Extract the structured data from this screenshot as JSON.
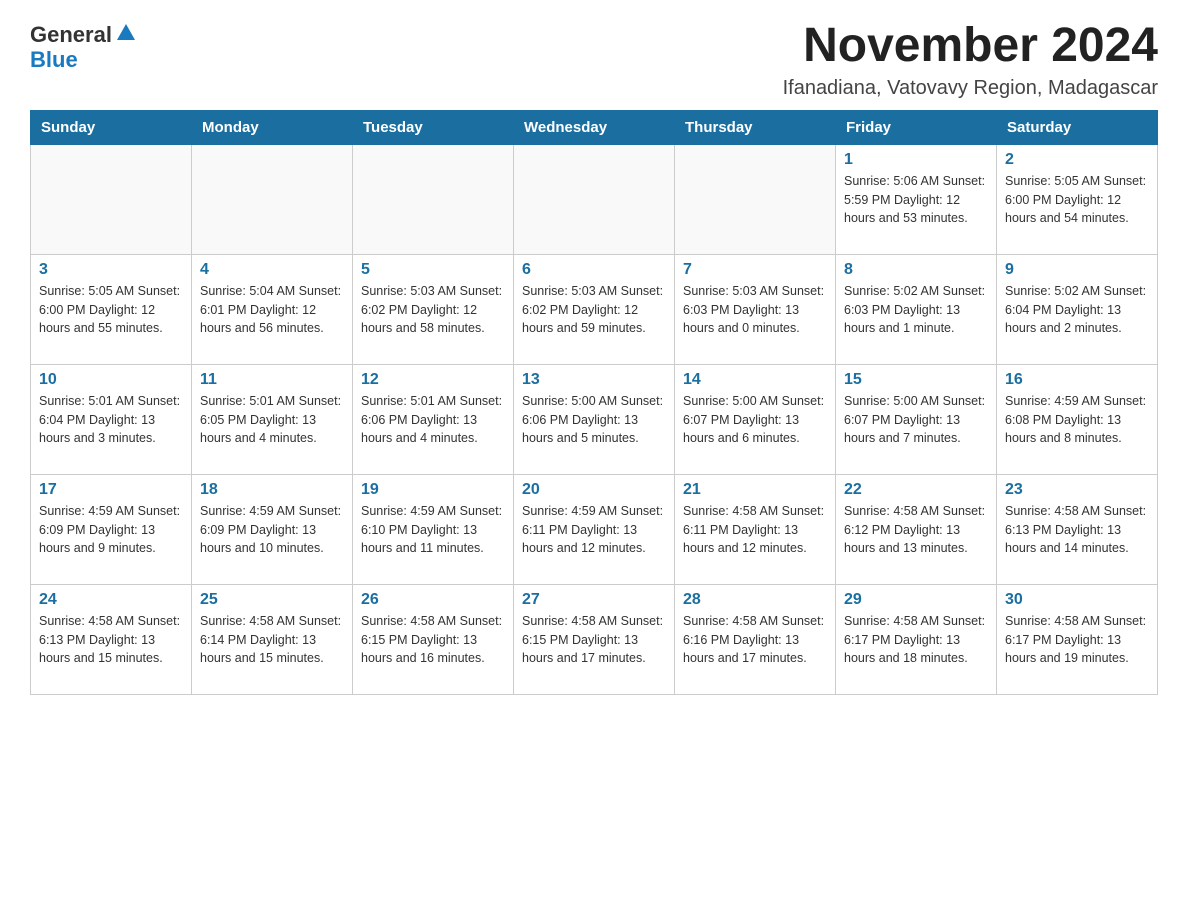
{
  "logo": {
    "general": "General",
    "blue": "Blue"
  },
  "title": "November 2024",
  "subtitle": "Ifanadiana, Vatovavy Region, Madagascar",
  "weekdays": [
    "Sunday",
    "Monday",
    "Tuesday",
    "Wednesday",
    "Thursday",
    "Friday",
    "Saturday"
  ],
  "weeks": [
    [
      {
        "day": "",
        "info": ""
      },
      {
        "day": "",
        "info": ""
      },
      {
        "day": "",
        "info": ""
      },
      {
        "day": "",
        "info": ""
      },
      {
        "day": "",
        "info": ""
      },
      {
        "day": "1",
        "info": "Sunrise: 5:06 AM\nSunset: 5:59 PM\nDaylight: 12 hours\nand 53 minutes."
      },
      {
        "day": "2",
        "info": "Sunrise: 5:05 AM\nSunset: 6:00 PM\nDaylight: 12 hours\nand 54 minutes."
      }
    ],
    [
      {
        "day": "3",
        "info": "Sunrise: 5:05 AM\nSunset: 6:00 PM\nDaylight: 12 hours\nand 55 minutes."
      },
      {
        "day": "4",
        "info": "Sunrise: 5:04 AM\nSunset: 6:01 PM\nDaylight: 12 hours\nand 56 minutes."
      },
      {
        "day": "5",
        "info": "Sunrise: 5:03 AM\nSunset: 6:02 PM\nDaylight: 12 hours\nand 58 minutes."
      },
      {
        "day": "6",
        "info": "Sunrise: 5:03 AM\nSunset: 6:02 PM\nDaylight: 12 hours\nand 59 minutes."
      },
      {
        "day": "7",
        "info": "Sunrise: 5:03 AM\nSunset: 6:03 PM\nDaylight: 13 hours\nand 0 minutes."
      },
      {
        "day": "8",
        "info": "Sunrise: 5:02 AM\nSunset: 6:03 PM\nDaylight: 13 hours\nand 1 minute."
      },
      {
        "day": "9",
        "info": "Sunrise: 5:02 AM\nSunset: 6:04 PM\nDaylight: 13 hours\nand 2 minutes."
      }
    ],
    [
      {
        "day": "10",
        "info": "Sunrise: 5:01 AM\nSunset: 6:04 PM\nDaylight: 13 hours\nand 3 minutes."
      },
      {
        "day": "11",
        "info": "Sunrise: 5:01 AM\nSunset: 6:05 PM\nDaylight: 13 hours\nand 4 minutes."
      },
      {
        "day": "12",
        "info": "Sunrise: 5:01 AM\nSunset: 6:06 PM\nDaylight: 13 hours\nand 4 minutes."
      },
      {
        "day": "13",
        "info": "Sunrise: 5:00 AM\nSunset: 6:06 PM\nDaylight: 13 hours\nand 5 minutes."
      },
      {
        "day": "14",
        "info": "Sunrise: 5:00 AM\nSunset: 6:07 PM\nDaylight: 13 hours\nand 6 minutes."
      },
      {
        "day": "15",
        "info": "Sunrise: 5:00 AM\nSunset: 6:07 PM\nDaylight: 13 hours\nand 7 minutes."
      },
      {
        "day": "16",
        "info": "Sunrise: 4:59 AM\nSunset: 6:08 PM\nDaylight: 13 hours\nand 8 minutes."
      }
    ],
    [
      {
        "day": "17",
        "info": "Sunrise: 4:59 AM\nSunset: 6:09 PM\nDaylight: 13 hours\nand 9 minutes."
      },
      {
        "day": "18",
        "info": "Sunrise: 4:59 AM\nSunset: 6:09 PM\nDaylight: 13 hours\nand 10 minutes."
      },
      {
        "day": "19",
        "info": "Sunrise: 4:59 AM\nSunset: 6:10 PM\nDaylight: 13 hours\nand 11 minutes."
      },
      {
        "day": "20",
        "info": "Sunrise: 4:59 AM\nSunset: 6:11 PM\nDaylight: 13 hours\nand 12 minutes."
      },
      {
        "day": "21",
        "info": "Sunrise: 4:58 AM\nSunset: 6:11 PM\nDaylight: 13 hours\nand 12 minutes."
      },
      {
        "day": "22",
        "info": "Sunrise: 4:58 AM\nSunset: 6:12 PM\nDaylight: 13 hours\nand 13 minutes."
      },
      {
        "day": "23",
        "info": "Sunrise: 4:58 AM\nSunset: 6:13 PM\nDaylight: 13 hours\nand 14 minutes."
      }
    ],
    [
      {
        "day": "24",
        "info": "Sunrise: 4:58 AM\nSunset: 6:13 PM\nDaylight: 13 hours\nand 15 minutes."
      },
      {
        "day": "25",
        "info": "Sunrise: 4:58 AM\nSunset: 6:14 PM\nDaylight: 13 hours\nand 15 minutes."
      },
      {
        "day": "26",
        "info": "Sunrise: 4:58 AM\nSunset: 6:15 PM\nDaylight: 13 hours\nand 16 minutes."
      },
      {
        "day": "27",
        "info": "Sunrise: 4:58 AM\nSunset: 6:15 PM\nDaylight: 13 hours\nand 17 minutes."
      },
      {
        "day": "28",
        "info": "Sunrise: 4:58 AM\nSunset: 6:16 PM\nDaylight: 13 hours\nand 17 minutes."
      },
      {
        "day": "29",
        "info": "Sunrise: 4:58 AM\nSunset: 6:17 PM\nDaylight: 13 hours\nand 18 minutes."
      },
      {
        "day": "30",
        "info": "Sunrise: 4:58 AM\nSunset: 6:17 PM\nDaylight: 13 hours\nand 19 minutes."
      }
    ]
  ]
}
